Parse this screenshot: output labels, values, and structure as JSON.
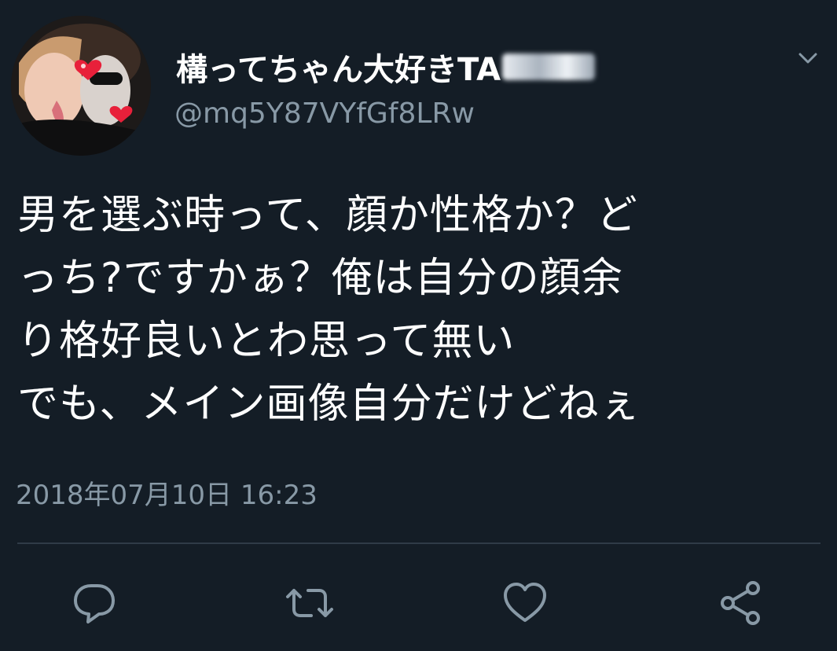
{
  "tweet": {
    "display_name": "構ってちゃん大好きTA",
    "handle": "@mq5Y87VYfGf8LRw",
    "text_lines": [
      "男を選ぶ時って、顔か性格か？ど",
      "っち?ですかぁ？俺は自分の顔余",
      "り格好良いとわ思って無い",
      "でも、メイン画像自分だけどねぇ"
    ],
    "timestamp": "2018年07月10日 16:23"
  },
  "icons": {
    "caret": "chevron-down-icon",
    "reply": "reply-icon",
    "retweet": "retweet-icon",
    "like": "heart-icon",
    "share": "share-icon"
  },
  "colors": {
    "background": "#141d26",
    "text": "#ffffff",
    "secondary": "#8899a6",
    "divider": "#2f3b47"
  }
}
